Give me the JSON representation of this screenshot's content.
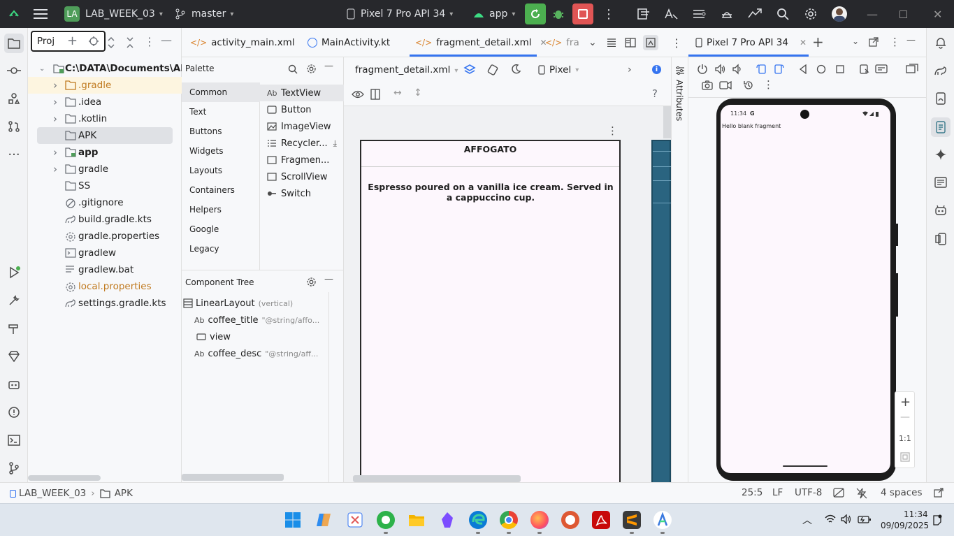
{
  "titlebar": {
    "project_badge": "LA",
    "project_name": "LAB_WEEK_03",
    "branch": "master",
    "device": "Pixel 7 Pro API 34",
    "run_config": "app"
  },
  "project_panel": {
    "tab_label": "Proj",
    "root_path": "C:\\DATA\\Documents\\ANDR",
    "items": [
      {
        "label": ".gradle"
      },
      {
        "label": ".idea"
      },
      {
        "label": ".kotlin"
      },
      {
        "label": "APK"
      },
      {
        "label": "app"
      },
      {
        "label": "gradle"
      },
      {
        "label": "SS"
      },
      {
        "label": ".gitignore"
      },
      {
        "label": "build.gradle.kts"
      },
      {
        "label": "gradle.properties"
      },
      {
        "label": "gradlew"
      },
      {
        "label": "gradlew.bat"
      },
      {
        "label": "local.properties"
      },
      {
        "label": "settings.gradle.kts"
      }
    ]
  },
  "editor_tabs": [
    {
      "label": "activity_main.xml"
    },
    {
      "label": "MainActivity.kt"
    },
    {
      "label": "fragment_detail.xml"
    },
    {
      "label": "frag"
    }
  ],
  "palette": {
    "title": "Palette",
    "categories": [
      "Common",
      "Text",
      "Buttons",
      "Widgets",
      "Layouts",
      "Containers",
      "Helpers",
      "Google",
      "Legacy"
    ],
    "items": [
      "TextView",
      "Button",
      "ImageView",
      "Recycler...",
      "Fragmen...",
      "ScrollView",
      "Switch"
    ]
  },
  "component_tree": {
    "title": "Component Tree",
    "root_label": "LinearLayout",
    "root_hint": "(vertical)",
    "nodes": [
      {
        "name": "coffee_title",
        "hint": "\"@string/affo..."
      },
      {
        "name": "view",
        "hint": ""
      },
      {
        "name": "coffee_desc",
        "hint": "\"@string/aff..."
      }
    ]
  },
  "design": {
    "file": "fragment_detail.xml",
    "device": "Pixel",
    "preview_title": "AFFOGATO",
    "preview_desc": "Espresso poured on a vanilla ice cream. Served in a cappuccino cup.",
    "attributes_label": "Attributes"
  },
  "running_devices": {
    "tab_label": "Pixel 7 Pro API 34",
    "phone_time": "11:34",
    "phone_g": "G",
    "phone_text": "Hello blank fragment",
    "zoom_ratio": "1:1"
  },
  "statusbar": {
    "crumb_project": "LAB_WEEK_03",
    "crumb_folder": "APK",
    "position": "25:5",
    "line_sep": "LF",
    "encoding": "UTF-8",
    "indent": "4 spaces"
  },
  "taskbar": {
    "time": "11:34",
    "date": "09/09/2025"
  },
  "colors": {
    "accent": "#3574f0",
    "run_green": "#4caf50",
    "stop_red": "#e05555",
    "folder_orange": "#c07a20",
    "titlebar": "#27282c"
  }
}
